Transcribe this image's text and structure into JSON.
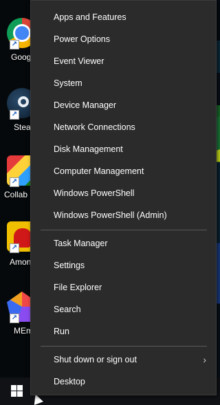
{
  "desktop": {
    "icons": [
      {
        "label": "Google Chrome",
        "icon": "chrome-icon"
      },
      {
        "label": "Steam",
        "icon": "steam-icon"
      },
      {
        "label": "Collab",
        "icon": "collab-app-icon"
      },
      {
        "label": "Among Us",
        "icon": "among-us-icon"
      },
      {
        "label": "MEmu",
        "icon": "memu-icon"
      }
    ]
  },
  "menu": {
    "group1": [
      "Apps and Features",
      "Power Options",
      "Event Viewer",
      "System",
      "Device Manager",
      "Network Connections",
      "Disk Management",
      "Computer Management",
      "Windows PowerShell",
      "Windows PowerShell (Admin)"
    ],
    "group2": [
      "Task Manager",
      "Settings",
      "File Explorer",
      "Search",
      "Run"
    ],
    "group3": [
      "Shut down or sign out",
      "Desktop"
    ],
    "submenu_glyph": "›"
  },
  "taskbar": {
    "start_icon": "windows-logo-icon"
  },
  "colors": {
    "menu_bg": "#2b2b2b",
    "menu_text": "#ffffff",
    "separator": "#5a5a5a",
    "taskbar_bg": "#101216"
  }
}
